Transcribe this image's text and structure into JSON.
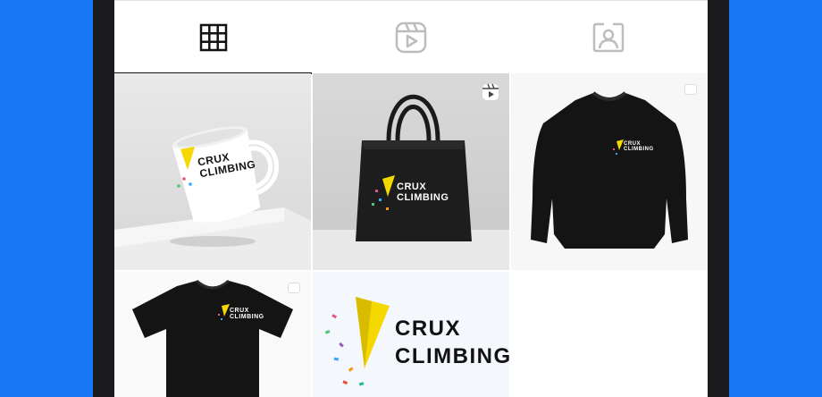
{
  "tabs": [
    {
      "name": "grid-tab",
      "icon": "grid-icon",
      "active": true
    },
    {
      "name": "reels-tab",
      "icon": "reels-icon",
      "active": false
    },
    {
      "name": "tagged-tab",
      "icon": "tagged-user-icon",
      "active": false
    }
  ],
  "brand": {
    "line1": "CRUX",
    "line2": "CLIMBING",
    "logo_color": "#f5d800",
    "text_color_dark": "#111111",
    "text_color_light": "#ffffff"
  },
  "posts": [
    {
      "item": "mug",
      "badge": "none"
    },
    {
      "item": "tote-bag",
      "badge": "reels-icon"
    },
    {
      "item": "sweatshirt",
      "badge": "multi-image-icon"
    },
    {
      "item": "t-shirt",
      "badge": "multi-image-icon"
    },
    {
      "item": "logo",
      "badge": "none"
    }
  ],
  "colors": {
    "background": "#1877f2",
    "phone_frame": "#1c1c1e",
    "active_tab_indicator": "#111111"
  }
}
